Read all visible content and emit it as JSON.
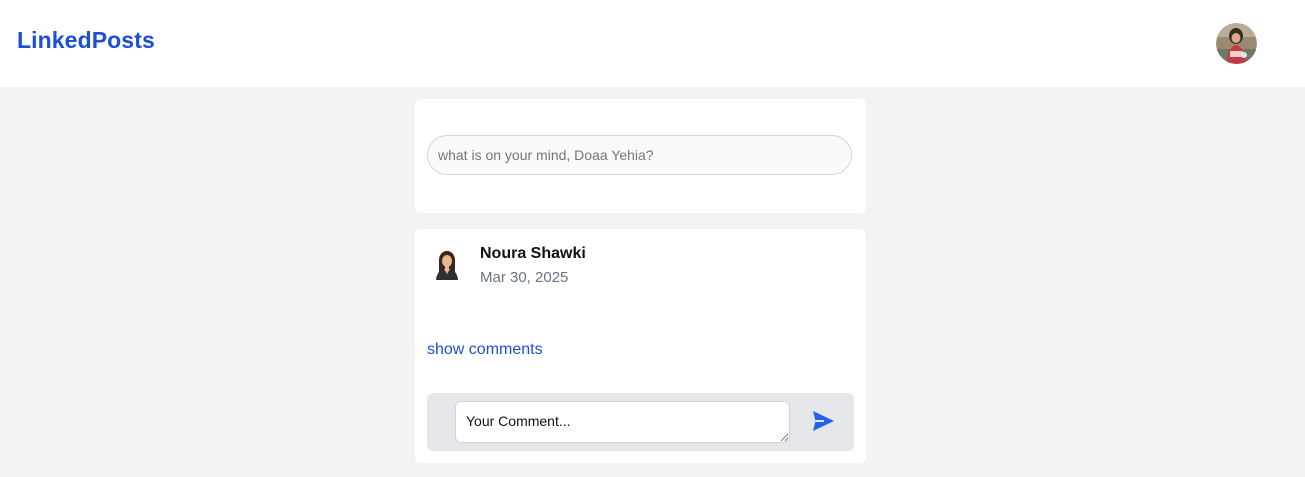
{
  "navbar": {
    "brand": "LinkedPosts",
    "avatar_icon": "user-avatar-icon"
  },
  "create_post": {
    "placeholder": "what is on your mind, Doaa Yehia?"
  },
  "post": {
    "author": "Noura Shawki",
    "date": "Mar 30, 2025",
    "show_comments_label": "show comments",
    "comment_placeholder": "Your Comment...",
    "send_icon": "send-icon"
  },
  "colors": {
    "brand": "#1d4ed8",
    "page_bg": "#f3f3f3",
    "card_bg": "#ffffff",
    "comment_bar_bg": "#e5e7eb"
  }
}
